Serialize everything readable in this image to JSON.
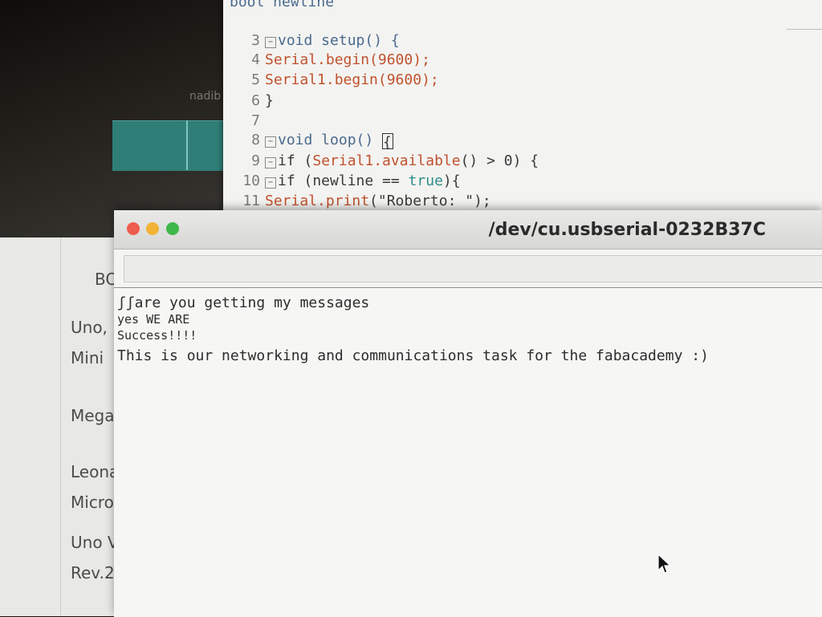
{
  "editor": {
    "top_partial": "bool newline",
    "lines": [
      {
        "num": "3",
        "fold": true,
        "segments": [
          {
            "t": "void setup() {",
            "c": "kw"
          }
        ]
      },
      {
        "num": "4",
        "fold": false,
        "segments": [
          {
            "t": "Serial.begin(9600);",
            "c": "fn"
          }
        ]
      },
      {
        "num": "5",
        "fold": false,
        "segments": [
          {
            "t": "Serial1.begin(9600);",
            "c": "fn"
          }
        ]
      },
      {
        "num": "6",
        "fold": false,
        "segments": [
          {
            "t": "}",
            "c": "str"
          }
        ]
      },
      {
        "num": "7",
        "fold": false,
        "segments": []
      },
      {
        "num": "8",
        "fold": true,
        "segments": [
          {
            "t": "void loop() ",
            "c": "kw"
          },
          {
            "t": "{",
            "c": "cursor"
          }
        ]
      },
      {
        "num": "9",
        "fold": true,
        "segments": [
          {
            "t": "if (",
            "c": "str"
          },
          {
            "t": "Serial1.available",
            "c": "fn"
          },
          {
            "t": "() > 0) {",
            "c": "str"
          }
        ]
      },
      {
        "num": "10",
        "fold": true,
        "segments": [
          {
            "t": "if (newline == ",
            "c": "str"
          },
          {
            "t": "true",
            "c": "lit"
          },
          {
            "t": "){",
            "c": "str"
          }
        ]
      },
      {
        "num": "11",
        "fold": false,
        "segments": [
          {
            "t": "Serial.print",
            "c": "fn"
          },
          {
            "t": "(\"Roberto: \");",
            "c": "str"
          }
        ]
      }
    ]
  },
  "background": {
    "ghost_labels": [
      "nadib"
    ]
  },
  "boards": {
    "header": "BO",
    "items": [
      "Uno,",
      "Mini",
      "Mega",
      "Leona",
      "Micro",
      "Uno V",
      "Rev.2"
    ]
  },
  "serial_monitor": {
    "title": "/dev/cu.usbserial-0232B37C",
    "input_value": "",
    "output_lines": [
      "ʃʃare you getting my messages",
      "yes WE ARE",
      "Success!!!!",
      "This is our networking and communications task for the fabacademy :)"
    ]
  }
}
